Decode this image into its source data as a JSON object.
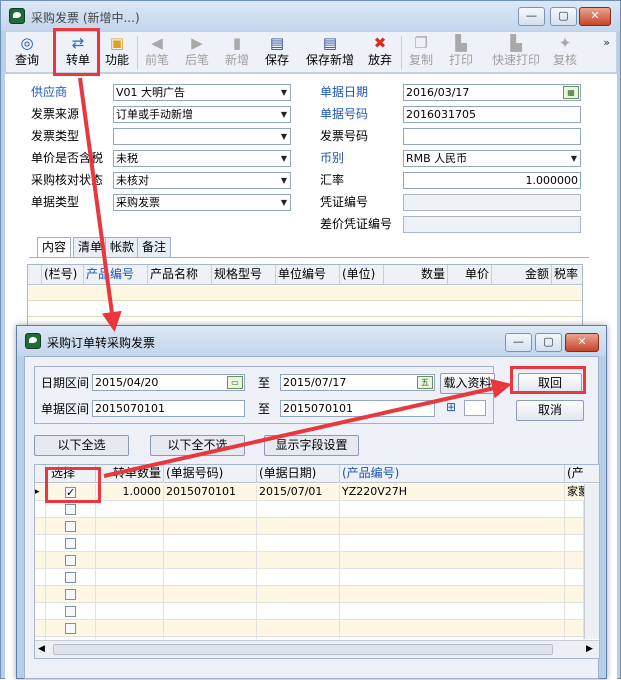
{
  "window": {
    "title": "采购发票 (新增中...)"
  },
  "toolbar": {
    "buttons": [
      {
        "label": "查询",
        "icon": "query-icon"
      },
      {
        "label": "转单",
        "icon": "transfer-icon"
      },
      {
        "label": "功能",
        "icon": "function-icon"
      },
      {
        "label": "前笔",
        "icon": "prev-icon"
      },
      {
        "label": "后笔",
        "icon": "next-icon"
      },
      {
        "label": "新增",
        "icon": "new-icon"
      },
      {
        "label": "保存",
        "icon": "save-icon"
      },
      {
        "label": "保存新增",
        "icon": "save-new-icon"
      },
      {
        "label": "放弃",
        "icon": "discard-icon"
      },
      {
        "label": "复制",
        "icon": "copy-icon"
      },
      {
        "label": "打印",
        "icon": "print-icon"
      },
      {
        "label": "快速打印",
        "icon": "quick-print-icon"
      },
      {
        "label": "复核",
        "icon": "review-icon"
      }
    ],
    "overflow": "»"
  },
  "form": {
    "supplier": {
      "label": "供应商",
      "value": "V01 大明广告"
    },
    "invoice_source": {
      "label": "发票来源",
      "value": "订单或手动新增"
    },
    "invoice_type": {
      "label": "发票类型",
      "value": ""
    },
    "tax_included": {
      "label": "单价是否含税",
      "value": "未税"
    },
    "verify_status": {
      "label": "采购核对状态",
      "value": "未核对"
    },
    "doc_type": {
      "label": "单据类型",
      "value": "采购发票"
    },
    "doc_date": {
      "label": "单据日期",
      "value": "2016/03/17"
    },
    "doc_no": {
      "label": "单据号码",
      "value": "2016031705"
    },
    "invoice_no": {
      "label": "发票号码",
      "value": ""
    },
    "currency": {
      "label": "币别",
      "value": "RMB 人民币"
    },
    "rate": {
      "label": "汇率",
      "value": "1.000000"
    },
    "voucher_no": {
      "label": "凭证编号",
      "value": ""
    },
    "diff_voucher_no": {
      "label": "差价凭证编号",
      "value": ""
    }
  },
  "tabs": [
    "内容",
    "清单",
    "帐款",
    "备注"
  ],
  "grid": {
    "columns": [
      "(栏号)",
      "产品编号",
      "产品名称",
      "规格型号",
      "单位编号",
      "(单位)",
      "数量",
      "单价",
      "金额",
      "税率"
    ]
  },
  "dialog": {
    "title": "采购订单转采购发票",
    "date_range": {
      "label": "日期区间",
      "from": "2015/04/20",
      "sep": "至",
      "to": "2015/07/17"
    },
    "doc_range": {
      "label": "单据区间",
      "from": "2015070101",
      "sep": "至",
      "to": "2015070101"
    },
    "load_button": "载入资料",
    "fetch_button": "取回",
    "cancel_button": "取消",
    "select_all": "以下全选",
    "select_none": "以下全不选",
    "field_settings": "显示字段设置",
    "columns": [
      "选择",
      "转单数量",
      "(单据号码)",
      "(单据日期)",
      "(产品编号)",
      "(产"
    ],
    "rows": [
      {
        "selected": true,
        "qty": "1.0000",
        "doc_no": "2015070101",
        "doc_date": "2015/07/01",
        "product": "YZ220V27H",
        "extra": "家蒙"
      }
    ],
    "empty_rows": 10
  }
}
